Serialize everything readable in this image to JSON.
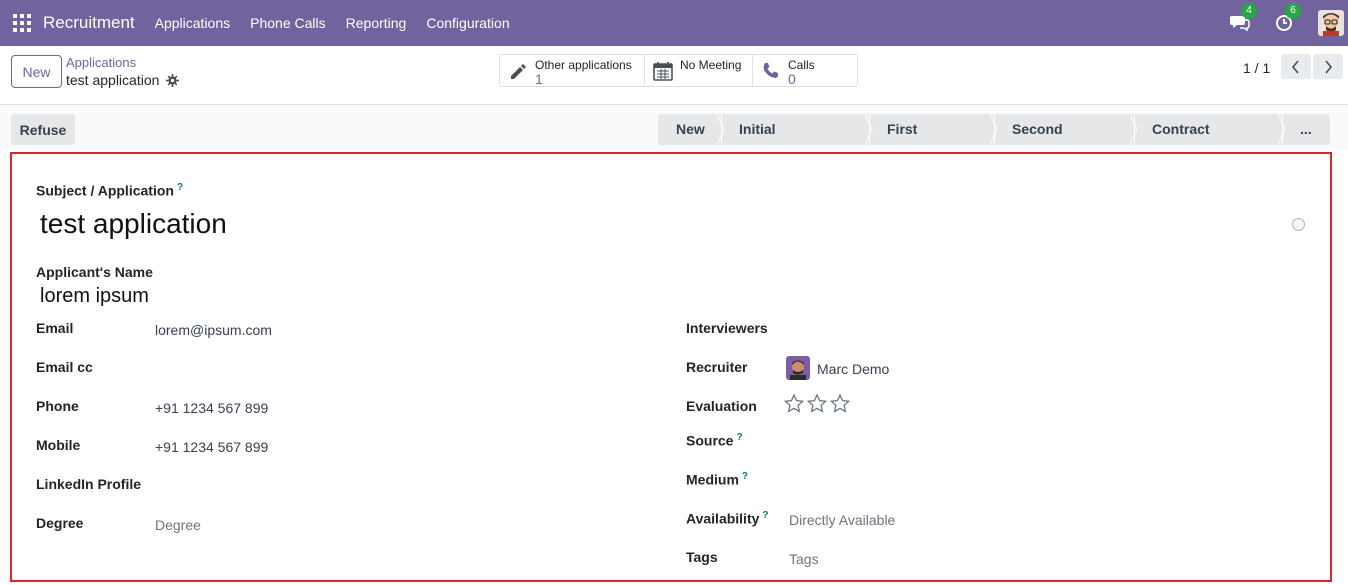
{
  "navbar": {
    "app_name": "Recruitment",
    "menu": [
      "Applications",
      "Phone Calls",
      "Reporting",
      "Configuration"
    ],
    "messages_count": "4",
    "activities_count": "6"
  },
  "control": {
    "new_label": "New",
    "breadcrumb": "Applications",
    "record_name": "test application",
    "smart_buttons": [
      {
        "label": "Other applications",
        "value": "1",
        "icon": "pencil-icon"
      },
      {
        "label": "No Meeting",
        "value": "",
        "icon": "calendar-icon"
      },
      {
        "label": "Calls",
        "value": "0",
        "icon": "phone-icon"
      }
    ],
    "pager": "1 / 1"
  },
  "statusbar": {
    "refuse_label": "Refuse",
    "stages": [
      "New",
      "Initial Qualification",
      "First Interview",
      "Second Interview",
      "Contract Proposal",
      "..."
    ]
  },
  "form": {
    "subject_label": "Subject / Application",
    "subject_value": "test application",
    "applicant_label": "Applicant's Name",
    "applicant_value": "lorem ipsum",
    "left": [
      {
        "label": "Email",
        "value": "lorem@ipsum.com",
        "placeholder": false
      },
      {
        "label": "Email cc",
        "value": "",
        "placeholder": false
      },
      {
        "label": "Phone",
        "value": "+91 1234 567 899",
        "placeholder": false
      },
      {
        "label": "Mobile",
        "value": "+91 1234 567 899",
        "placeholder": false
      },
      {
        "label": "LinkedIn Profile",
        "value": "",
        "placeholder": false
      },
      {
        "label": "Degree",
        "value": "Degree",
        "placeholder": true
      }
    ],
    "right": {
      "interviewers_label": "Interviewers",
      "recruiter_label": "Recruiter",
      "recruiter_value": "Marc Demo",
      "evaluation_label": "Evaluation",
      "evaluation_stars": 0,
      "source_label": "Source",
      "medium_label": "Medium",
      "availability_label": "Availability",
      "availability_placeholder": "Directly Available",
      "tags_label": "Tags",
      "tags_placeholder": "Tags"
    },
    "help_mark": "?"
  },
  "colors": {
    "brand": "#71639e",
    "highlight_border": "#dc2430",
    "badge": "#28a745"
  }
}
